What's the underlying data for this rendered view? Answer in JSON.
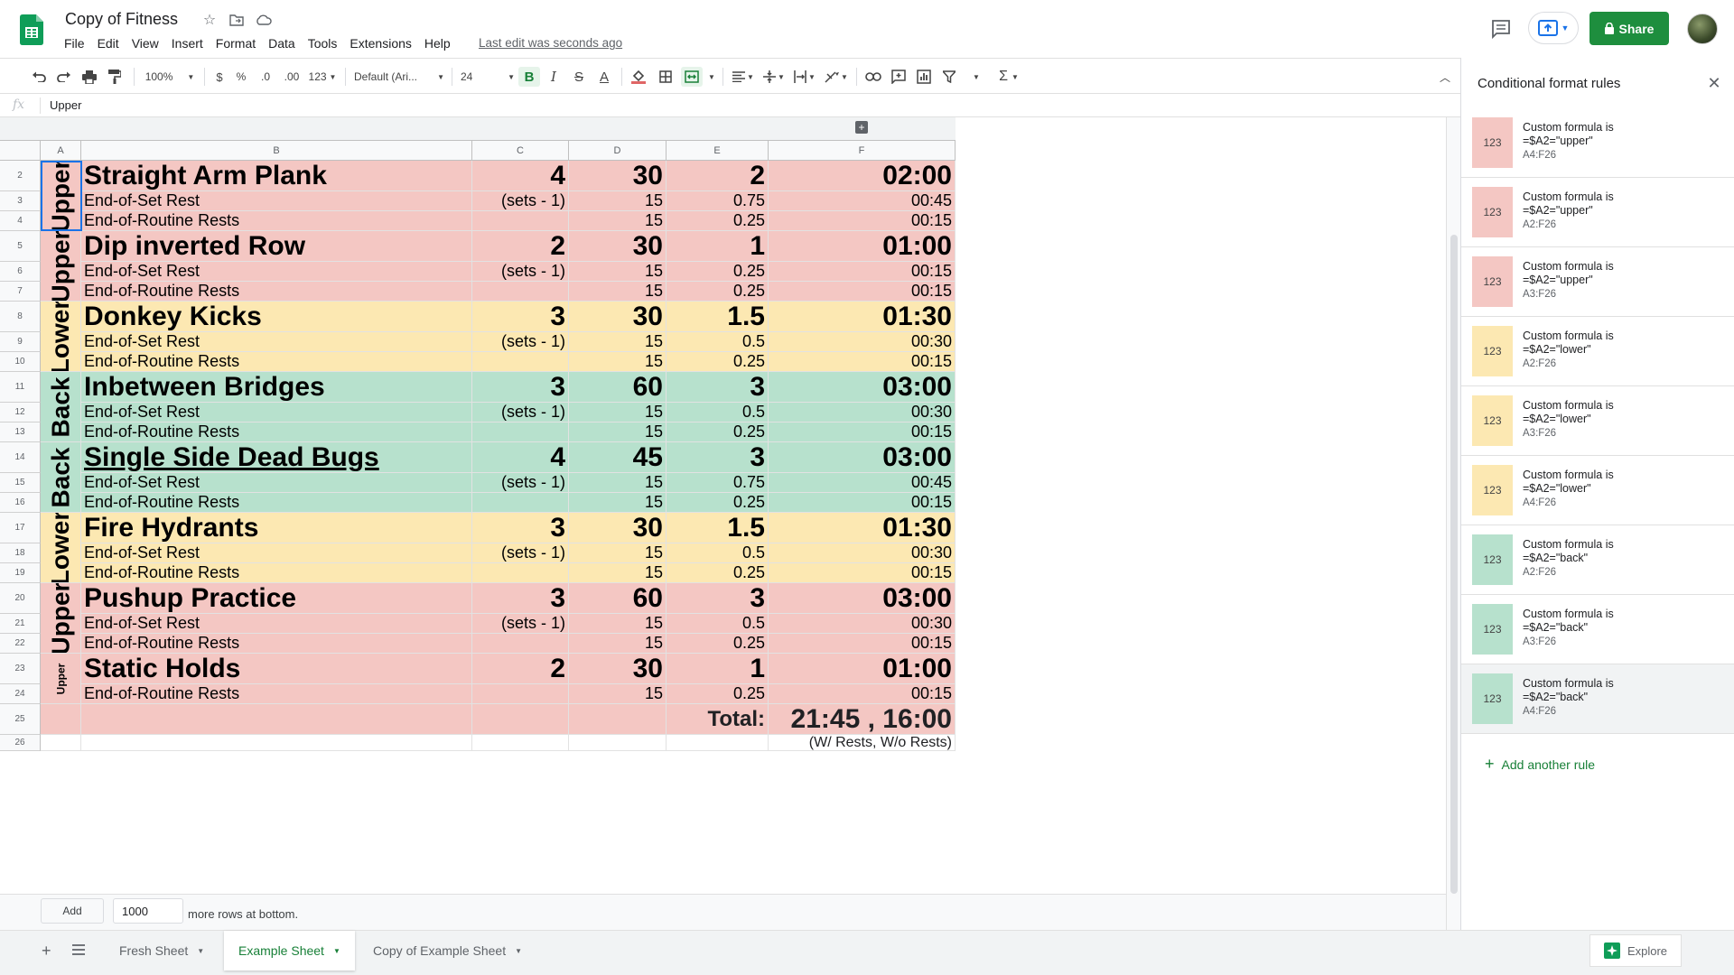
{
  "app": {
    "doc_title": "Copy of Fitness",
    "last_edit": "Last edit was seconds ago",
    "share_label": "Share",
    "menu": [
      "File",
      "Edit",
      "View",
      "Insert",
      "Format",
      "Data",
      "Tools",
      "Extensions",
      "Help"
    ]
  },
  "toolbar": {
    "zoom": "100%",
    "currency": "$",
    "percent": "%",
    "dec_decrease": ".0",
    "dec_increase": ".00",
    "more_formats": "123",
    "font": "Default (Ari...",
    "font_size": "24"
  },
  "formula_bar": {
    "fx": "fx",
    "value": "Upper"
  },
  "columns": [
    "A",
    "B",
    "C",
    "D",
    "E",
    "F"
  ],
  "row_numbers": [
    "2",
    "3",
    "4",
    "5",
    "6",
    "7",
    "8",
    "9",
    "10",
    "11",
    "12",
    "13",
    "14",
    "15",
    "16",
    "17",
    "18",
    "19",
    "20",
    "21",
    "22",
    "23",
    "24",
    "25",
    "26"
  ],
  "groups": [
    {
      "label": "Upper",
      "color": "pink"
    },
    {
      "label": "Upper",
      "color": "pink"
    },
    {
      "label": "Lower",
      "color": "yellow"
    },
    {
      "label": "Back",
      "color": "green"
    },
    {
      "label": "Back",
      "color": "green"
    },
    {
      "label": "Lower",
      "color": "yellow"
    },
    {
      "label": "Upper",
      "color": "pink"
    },
    {
      "label": "Upper",
      "color": "pink"
    }
  ],
  "rows": [
    {
      "color": "pink",
      "kind": "big",
      "b": "Straight Arm Plank",
      "c": "4",
      "d": "30",
      "e": "2",
      "f": "02:00"
    },
    {
      "color": "pink",
      "kind": "small",
      "b": "End-of-Set Rest",
      "c": "(sets - 1)",
      "d": "15",
      "e": "0.75",
      "f": "00:45"
    },
    {
      "color": "pink",
      "kind": "small",
      "b": "End-of-Routine Rests",
      "c": "",
      "d": "15",
      "e": "0.25",
      "f": "00:15"
    },
    {
      "color": "pink",
      "kind": "big",
      "b": "Dip inverted Row",
      "c": "2",
      "d": "30",
      "e": "1",
      "f": "01:00"
    },
    {
      "color": "pink",
      "kind": "small",
      "b": "End-of-Set Rest",
      "c": "(sets - 1)",
      "d": "15",
      "e": "0.25",
      "f": "00:15"
    },
    {
      "color": "pink",
      "kind": "small",
      "b": "End-of-Routine Rests",
      "c": "",
      "d": "15",
      "e": "0.25",
      "f": "00:15"
    },
    {
      "color": "yellow",
      "kind": "big",
      "b": "Donkey Kicks",
      "c": "3",
      "d": "30",
      "e": "1.5",
      "f": "01:30"
    },
    {
      "color": "yellow",
      "kind": "small",
      "b": "End-of-Set Rest",
      "c": "(sets - 1)",
      "d": "15",
      "e": "0.5",
      "f": "00:30"
    },
    {
      "color": "yellow",
      "kind": "small",
      "b": "End-of-Routine Rests",
      "c": "",
      "d": "15",
      "e": "0.25",
      "f": "00:15"
    },
    {
      "color": "green",
      "kind": "big",
      "b": "Inbetween Bridges",
      "c": "3",
      "d": "60",
      "e": "3",
      "f": "03:00"
    },
    {
      "color": "green",
      "kind": "small",
      "b": "End-of-Set Rest",
      "c": "(sets - 1)",
      "d": "15",
      "e": "0.5",
      "f": "00:30"
    },
    {
      "color": "green",
      "kind": "small",
      "b": "End-of-Routine Rests",
      "c": "",
      "d": "15",
      "e": "0.25",
      "f": "00:15"
    },
    {
      "color": "green",
      "kind": "big",
      "b": "Single Side Dead Bugs",
      "c": "4",
      "d": "45",
      "e": "3",
      "f": "03:00",
      "underline": true
    },
    {
      "color": "green",
      "kind": "small",
      "b": "End-of-Set Rest",
      "c": "(sets - 1)",
      "d": "15",
      "e": "0.75",
      "f": "00:45"
    },
    {
      "color": "green",
      "kind": "small",
      "b": "End-of-Routine Rests",
      "c": "",
      "d": "15",
      "e": "0.25",
      "f": "00:15"
    },
    {
      "color": "yellow",
      "kind": "big",
      "b": "Fire Hydrants",
      "c": "3",
      "d": "30",
      "e": "1.5",
      "f": "01:30"
    },
    {
      "color": "yellow",
      "kind": "small",
      "b": "End-of-Set Rest",
      "c": "(sets - 1)",
      "d": "15",
      "e": "0.5",
      "f": "00:30"
    },
    {
      "color": "yellow",
      "kind": "small",
      "b": "End-of-Routine Rests",
      "c": "",
      "d": "15",
      "e": "0.25",
      "f": "00:15"
    },
    {
      "color": "pink",
      "kind": "big",
      "b": "Pushup Practice",
      "c": "3",
      "d": "60",
      "e": "3",
      "f": "03:00"
    },
    {
      "color": "pink",
      "kind": "small",
      "b": "End-of-Set Rest",
      "c": "(sets - 1)",
      "d": "15",
      "e": "0.5",
      "f": "00:30"
    },
    {
      "color": "pink",
      "kind": "small",
      "b": "End-of-Routine Rests",
      "c": "",
      "d": "15",
      "e": "0.25",
      "f": "00:15"
    },
    {
      "color": "pink",
      "kind": "big",
      "b": "Static Holds",
      "c": "2",
      "d": "30",
      "e": "1",
      "f": "01:00"
    },
    {
      "color": "pink",
      "kind": "small",
      "b": "End-of-Routine Rests",
      "c": "",
      "d": "15",
      "e": "0.25",
      "f": "00:15"
    }
  ],
  "total": {
    "label": "Total:",
    "value": "21:45 , 16:00",
    "note": "(W/ Rests, W/o Rests)"
  },
  "add_rows": {
    "button": "Add",
    "count": "1000",
    "text": "more rows at bottom."
  },
  "sheets": [
    {
      "name": "Fresh Sheet",
      "active": false
    },
    {
      "name": "Example Sheet",
      "active": true
    },
    {
      "name": "Copy of Example Sheet",
      "active": false
    }
  ],
  "explore_label": "Explore",
  "panel": {
    "title": "Conditional format rules",
    "add_rule": "Add another rule",
    "rules": [
      {
        "swatch": "123",
        "color": "#f4c7c3",
        "label": "Custom formula is",
        "formula": "=$A2=\"upper\"",
        "range": "A4:F26"
      },
      {
        "swatch": "123",
        "color": "#f4c7c3",
        "label": "Custom formula is",
        "formula": "=$A2=\"upper\"",
        "range": "A2:F26"
      },
      {
        "swatch": "123",
        "color": "#f4c7c3",
        "label": "Custom formula is",
        "formula": "=$A2=\"upper\"",
        "range": "A3:F26"
      },
      {
        "swatch": "123",
        "color": "#fce8b2",
        "label": "Custom formula is",
        "formula": "=$A2=\"lower\"",
        "range": "A2:F26"
      },
      {
        "swatch": "123",
        "color": "#fce8b2",
        "label": "Custom formula is",
        "formula": "=$A2=\"lower\"",
        "range": "A3:F26"
      },
      {
        "swatch": "123",
        "color": "#fce8b2",
        "label": "Custom formula is",
        "formula": "=$A2=\"lower\"",
        "range": "A4:F26"
      },
      {
        "swatch": "123",
        "color": "#b7e1cd",
        "label": "Custom formula is",
        "formula": "=$A2=\"back\"",
        "range": "A2:F26"
      },
      {
        "swatch": "123",
        "color": "#b7e1cd",
        "label": "Custom formula is",
        "formula": "=$A2=\"back\"",
        "range": "A3:F26"
      },
      {
        "swatch": "123",
        "color": "#b7e1cd",
        "label": "Custom formula is",
        "formula": "=$A2=\"back\"",
        "range": "A4:F26",
        "highlighted": true
      }
    ]
  }
}
